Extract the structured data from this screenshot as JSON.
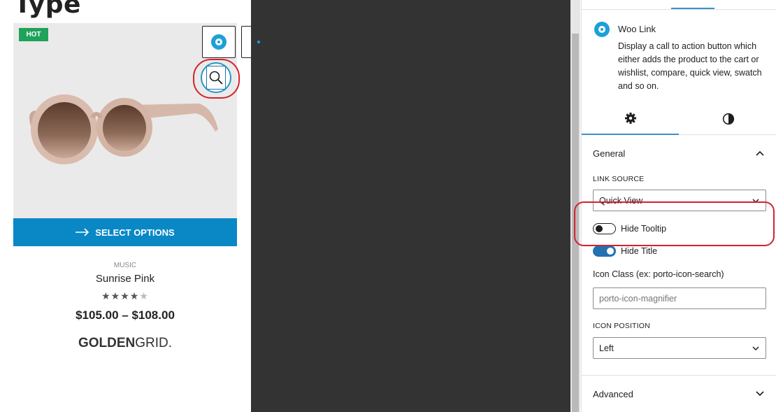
{
  "canvas": {
    "page_title": "Type",
    "product": {
      "badge": "HOT",
      "button_label": "SELECT OPTIONS",
      "category": "MUSIC",
      "name": "Sunrise Pink",
      "rating_stars": "★★★★★",
      "rating_value": 4.5,
      "price": "$105.00 – $108.00",
      "brand_bold": "GOLDEN",
      "brand_rest": "GRID."
    }
  },
  "block_toolbar": {
    "block_icon": "woo-link-icon",
    "drag_icon": "drag-handle-icon",
    "move_icon": "move-up-down-icon",
    "options_icon": "more-options-icon"
  },
  "sidebar": {
    "block_title": "Woo Link",
    "block_description": "Display a call to action button which either adds the product to the cart or wishlist, compare, quick view, swatch and so on.",
    "tabs": [
      {
        "icon": "gear-icon",
        "active": true
      },
      {
        "icon": "styles-icon",
        "active": false
      }
    ],
    "general": {
      "title": "General",
      "link_source_label": "LINK SOURCE",
      "link_source_value": "Quick View",
      "hide_tooltip_label": "Hide Tooltip",
      "hide_tooltip_on": false,
      "hide_title_label": "Hide Title",
      "hide_title_on": true,
      "icon_class_label": "Icon Class (ex: porto-icon-search)",
      "icon_class_value": "porto-icon-magnifier",
      "icon_position_label": "ICON POSITION",
      "icon_position_value": "Left"
    },
    "advanced": {
      "title": "Advanced"
    }
  },
  "colors": {
    "accent": "#0a88c6",
    "wp_blue": "#2271b1",
    "badge_green": "#1fa25a",
    "highlight_red": "#d3232d",
    "editor_dark": "#333333"
  }
}
